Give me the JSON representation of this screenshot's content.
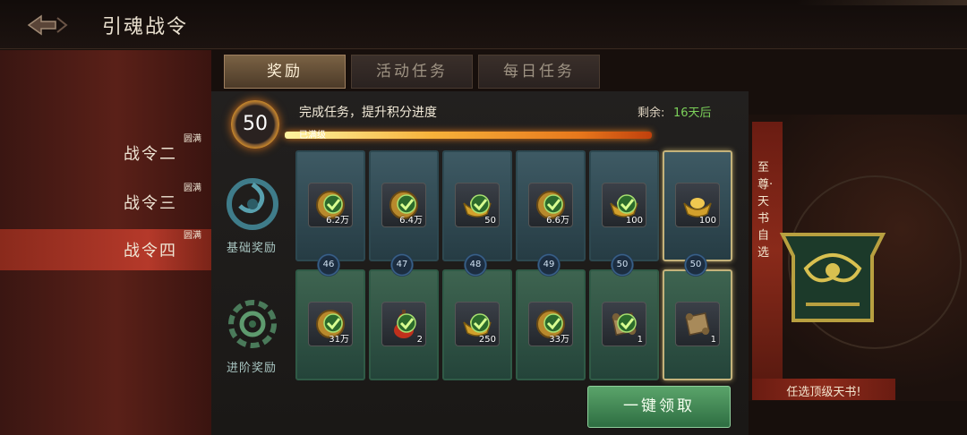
{
  "header": {
    "title": "引魂战令"
  },
  "sidebar": {
    "items": [
      {
        "label": "战令二",
        "badge": "圆满"
      },
      {
        "label": "战令三",
        "badge": "圆满"
      },
      {
        "label": "战令四",
        "badge": "圆满",
        "active": true
      }
    ]
  },
  "tabs": [
    {
      "label": "奖励",
      "active": true
    },
    {
      "label": "活动任务",
      "active": false
    },
    {
      "label": "每日任务",
      "active": false
    }
  ],
  "progress": {
    "level": "50",
    "task_text": "完成任务，提升积分进度",
    "maxed_label": "已满级",
    "remain_label": "剩余:",
    "remain_value": "16天后",
    "fill": 1.0
  },
  "rows": {
    "basic_label": "基础奖励",
    "advanced_label": "进阶奖励"
  },
  "levels": [
    "46",
    "47",
    "48",
    "49",
    "50",
    "50"
  ],
  "basic_rewards": [
    {
      "icon": "coin-icon",
      "qty": "6.2万",
      "claimed": true
    },
    {
      "icon": "coin-icon",
      "qty": "6.4万",
      "claimed": true
    },
    {
      "icon": "gold-ingot-icon",
      "qty": "50",
      "claimed": true
    },
    {
      "icon": "coin-icon",
      "qty": "6.6万",
      "claimed": true
    },
    {
      "icon": "gold-ingot-icon",
      "qty": "100",
      "claimed": true
    },
    {
      "icon": "gold-ingot-icon",
      "qty": "100",
      "claimed": false
    }
  ],
  "advanced_rewards": [
    {
      "icon": "coin-icon",
      "qty": "31万",
      "claimed": true
    },
    {
      "icon": "gourd-icon",
      "qty": "2",
      "claimed": true
    },
    {
      "icon": "gold-ingot-icon",
      "qty": "250",
      "claimed": true
    },
    {
      "icon": "coin-icon",
      "qty": "33万",
      "claimed": true
    },
    {
      "icon": "scroll-icon",
      "qty": "1",
      "claimed": true
    },
    {
      "icon": "scroll-icon",
      "qty": "1",
      "claimed": false
    }
  ],
  "right_panel": {
    "supreme_text": "至尊·天书自选",
    "pick_text": "任选顶级天书!"
  },
  "claim_button": {
    "label": "一键领取"
  },
  "colors": {
    "accent_green": "#7cd15a",
    "active_tab": "#7a6244",
    "sidebar_active": "#b5392a"
  }
}
